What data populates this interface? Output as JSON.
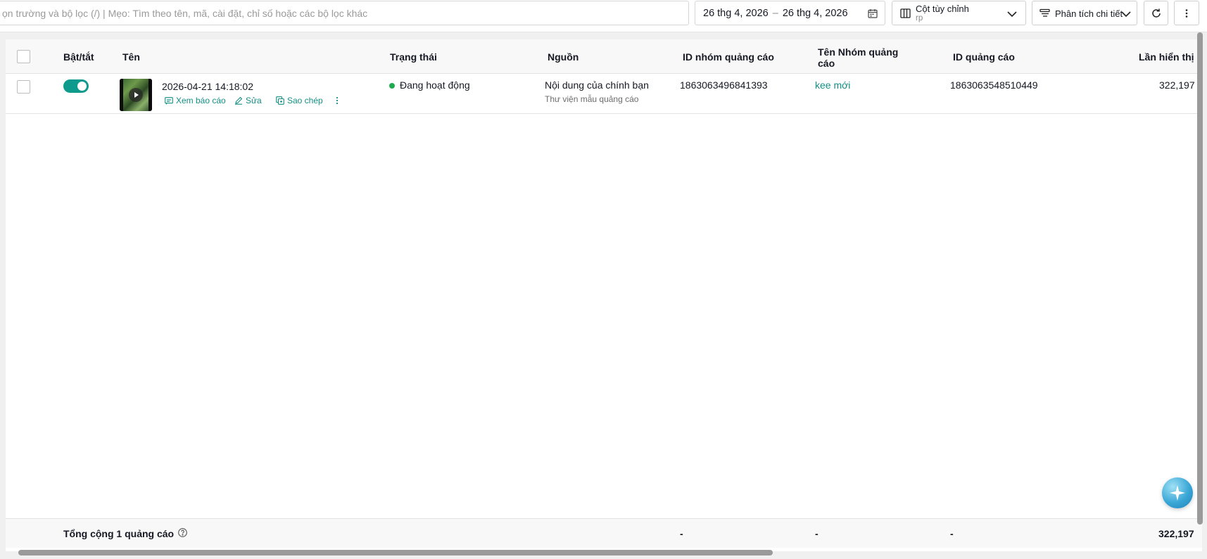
{
  "toolbar": {
    "search_placeholder": "ọn trường và bộ lọc (/) | Mẹo: Tìm theo tên, mã, cài đặt, chỉ số hoặc các bộ lọc khác",
    "date_start": "26 thg 4, 2026",
    "date_sep": "–",
    "date_end": "26 thg 4, 2026",
    "columns_label": "Cột tùy chỉnh",
    "columns_value": "rp",
    "analysis_label": "Phân tích chi tiết"
  },
  "table": {
    "headers": {
      "toggle": "Bật/tắt",
      "name": "Tên",
      "status": "Trạng thái",
      "source": "Nguồn",
      "adgroup_id": "ID nhóm quảng cáo",
      "adgroup_name_line1": "Tên Nhóm quảng",
      "adgroup_name_line2": "cáo",
      "ad_id": "ID quảng cáo",
      "impressions": "Lần hiển thị"
    },
    "rows": [
      {
        "name": "2026-04-21 14:18:02",
        "action_report": "Xem báo cáo",
        "action_edit": "Sửa",
        "action_copy": "Sao chép",
        "status": "Đang hoạt động",
        "source": "Nội dung của chính bạn",
        "source_sub": "Thư viện mẫu quảng cáo",
        "adgroup_id": "1863063496841393",
        "adgroup_name": "kee mới",
        "ad_id": "1863063548510449",
        "impressions": "322,197"
      }
    ],
    "footer": {
      "total": "Tổng cộng 1 quảng cáo",
      "adgroup_id": "-",
      "adgroup_name": "-",
      "ad_id": "-",
      "impressions": "322,197"
    }
  },
  "colors": {
    "accent": "#0e9a8c",
    "link": "#138f84",
    "status_active": "#1cab4f"
  }
}
